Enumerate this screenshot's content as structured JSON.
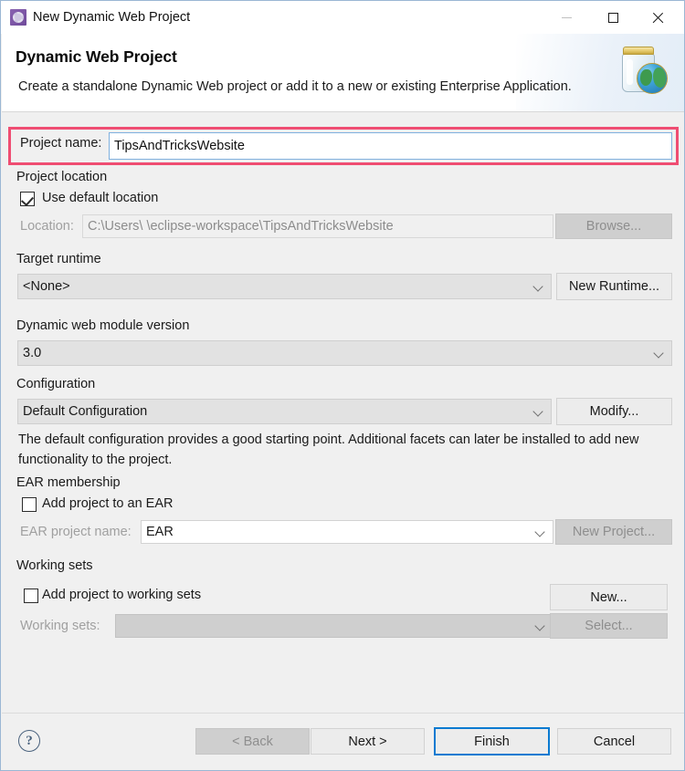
{
  "window": {
    "title": "New Dynamic Web Project",
    "icon": "eclipse-wizard-icon",
    "minimize_label": "–",
    "maximize_label": "□",
    "close_label": "✕"
  },
  "header": {
    "title": "Dynamic Web Project",
    "description": "Create a standalone Dynamic Web project or add it to a new or existing Enterprise Application.",
    "icon": "jar-globe-icon"
  },
  "project_name": {
    "label": "Project name:",
    "value": "TipsAndTricksWebsite",
    "highlight_color": "#ef4d72"
  },
  "project_location": {
    "group_label": "Project location",
    "use_default_label": "Use default location",
    "use_default_checked": true,
    "location_label": "Location:",
    "location_value": "C:\\Users\\            \\eclipse-workspace\\TipsAndTricksWebsite",
    "browse_label": "Browse..."
  },
  "target_runtime": {
    "group_label": "Target runtime",
    "value": "<None>",
    "new_runtime_label": "New Runtime..."
  },
  "module_version": {
    "group_label": "Dynamic web module version",
    "value": "3.0"
  },
  "configuration": {
    "group_label": "Configuration",
    "value": "Default Configuration",
    "modify_label": "Modify...",
    "description": "The default configuration provides a good starting point. Additional facets can later be installed to add new functionality to the project."
  },
  "ear_membership": {
    "group_label": "EAR membership",
    "add_to_ear_label": "Add project to an EAR",
    "add_to_ear_checked": false,
    "ear_project_name_label": "EAR project name:",
    "ear_project_name_value": "EAR",
    "new_project_label": "New Project..."
  },
  "working_sets": {
    "group_label": "Working sets",
    "add_to_working_sets_label": "Add project to working sets",
    "add_to_working_sets_checked": false,
    "working_sets_label": "Working sets:",
    "working_sets_value": "",
    "new_label": "New...",
    "select_label": "Select..."
  },
  "footer": {
    "help_label": "?",
    "back_label": "< Back",
    "next_label": "Next >",
    "finish_label": "Finish",
    "cancel_label": "Cancel"
  }
}
